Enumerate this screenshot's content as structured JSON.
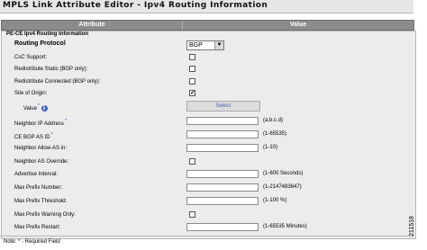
{
  "title": "MPLS Link Attribute Editor - Ipv4 Routing Information",
  "columns": {
    "attribute": "Attribute",
    "value": "Value"
  },
  "section": "PE-CE Ipv4 Routing Information",
  "routing_protocol": {
    "label": "Routing Protocol",
    "selected": "BGP"
  },
  "fields": {
    "csc_support": {
      "label": "CsC Support:",
      "checked": false
    },
    "redistribute_static": {
      "label": "Redistribute Static (BGP only):",
      "checked": false
    },
    "redistribute_connected": {
      "label": "Redistribute Connected (BGP only):",
      "checked": false
    },
    "site_of_origin": {
      "label": "Site of Origin:",
      "checked": true,
      "check_mark": "✓"
    },
    "soo_value": {
      "label": "Value",
      "required_mark": "*",
      "button": "Select"
    },
    "neighbor_ip": {
      "label": "Neighbor IP Address",
      "required_mark": "*",
      "hint": "(a.b.c.d)",
      "value": ""
    },
    "ce_bgp_as_id": {
      "label": "CE BGP AS ID",
      "required_mark": "*",
      "hint": "(1-65535)",
      "value": ""
    },
    "neighbor_allow_as": {
      "label": "Neighbor Allow-AS in:",
      "hint": "(1-10)",
      "value": ""
    },
    "neighbor_as_override": {
      "label": "Neighbor AS Override:",
      "checked": false
    },
    "advertise_interval": {
      "label": "Advertise Interval:",
      "hint": "(1-600 Seconds)",
      "value": ""
    },
    "max_prefix_number": {
      "label": "Max Prefix Number:",
      "hint": "(1-2147483647)",
      "value": ""
    },
    "max_prefix_threshold": {
      "label": "Max Prefix Threshold:",
      "hint": "(1-100 %)",
      "value": ""
    },
    "max_prefix_warning_only": {
      "label": "Max Prefix Warning Only:",
      "checked": false
    },
    "max_prefix_restart": {
      "label": "Max Prefix Restart:",
      "hint": "(1-65535 Minutes)",
      "value": ""
    }
  },
  "footnote": "Note: * - Required Field",
  "figure_id": "211518",
  "colors": {
    "header_bg": "#8c8c8c",
    "body_bg": "#ececec",
    "title_bg": "#e6e6e6",
    "required": "#2a4db0"
  },
  "icons": {
    "info": "info-circle-icon",
    "dropdown": "chevron-down-icon"
  }
}
